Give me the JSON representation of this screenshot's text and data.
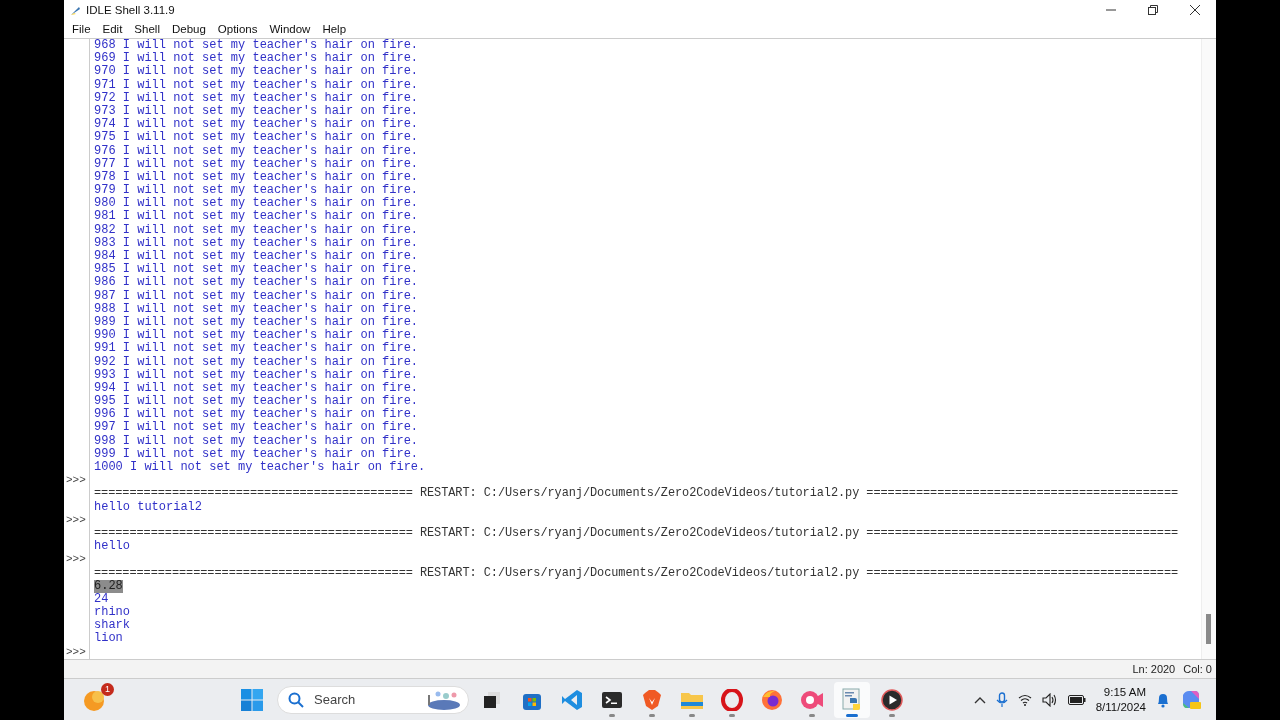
{
  "window": {
    "title": "IDLE Shell 3.11.9"
  },
  "menu": [
    "File",
    "Edit",
    "Shell",
    "Debug",
    "Options",
    "Window",
    "Help"
  ],
  "shell_lines": [
    {
      "kind": "output",
      "text": "968 I will not set my teacher's hair on fire."
    },
    {
      "kind": "output",
      "text": "969 I will not set my teacher's hair on fire."
    },
    {
      "kind": "output",
      "text": "970 I will not set my teacher's hair on fire."
    },
    {
      "kind": "output",
      "text": "971 I will not set my teacher's hair on fire."
    },
    {
      "kind": "output",
      "text": "972 I will not set my teacher's hair on fire."
    },
    {
      "kind": "output",
      "text": "973 I will not set my teacher's hair on fire."
    },
    {
      "kind": "output",
      "text": "974 I will not set my teacher's hair on fire."
    },
    {
      "kind": "output",
      "text": "975 I will not set my teacher's hair on fire."
    },
    {
      "kind": "output",
      "text": "976 I will not set my teacher's hair on fire."
    },
    {
      "kind": "output",
      "text": "977 I will not set my teacher's hair on fire."
    },
    {
      "kind": "output",
      "text": "978 I will not set my teacher's hair on fire."
    },
    {
      "kind": "output",
      "text": "979 I will not set my teacher's hair on fire."
    },
    {
      "kind": "output",
      "text": "980 I will not set my teacher's hair on fire."
    },
    {
      "kind": "output",
      "text": "981 I will not set my teacher's hair on fire."
    },
    {
      "kind": "output",
      "text": "982 I will not set my teacher's hair on fire."
    },
    {
      "kind": "output",
      "text": "983 I will not set my teacher's hair on fire."
    },
    {
      "kind": "output",
      "text": "984 I will not set my teacher's hair on fire."
    },
    {
      "kind": "output",
      "text": "985 I will not set my teacher's hair on fire."
    },
    {
      "kind": "output",
      "text": "986 I will not set my teacher's hair on fire."
    },
    {
      "kind": "output",
      "text": "987 I will not set my teacher's hair on fire."
    },
    {
      "kind": "output",
      "text": "988 I will not set my teacher's hair on fire."
    },
    {
      "kind": "output",
      "text": "989 I will not set my teacher's hair on fire."
    },
    {
      "kind": "output",
      "text": "990 I will not set my teacher's hair on fire."
    },
    {
      "kind": "output",
      "text": "991 I will not set my teacher's hair on fire."
    },
    {
      "kind": "output",
      "text": "992 I will not set my teacher's hair on fire."
    },
    {
      "kind": "output",
      "text": "993 I will not set my teacher's hair on fire."
    },
    {
      "kind": "output",
      "text": "994 I will not set my teacher's hair on fire."
    },
    {
      "kind": "output",
      "text": "995 I will not set my teacher's hair on fire."
    },
    {
      "kind": "output",
      "text": "996 I will not set my teacher's hair on fire."
    },
    {
      "kind": "output",
      "text": "997 I will not set my teacher's hair on fire."
    },
    {
      "kind": "output",
      "text": "998 I will not set my teacher's hair on fire."
    },
    {
      "kind": "output",
      "text": "999 I will not set my teacher's hair on fire."
    },
    {
      "kind": "output",
      "text": "1000 I will not set my teacher's hair on fire."
    },
    {
      "kind": "prompt",
      "prompt": ">>>"
    },
    {
      "kind": "restart",
      "text": "============================================= RESTART: C:/Users/ryanj/Documents/Zero2CodeVideos/tutorial2.py ============================================"
    },
    {
      "kind": "output",
      "text": "hello tutorial2"
    },
    {
      "kind": "prompt",
      "prompt": ">>>"
    },
    {
      "kind": "restart",
      "text": "============================================= RESTART: C:/Users/ryanj/Documents/Zero2CodeVideos/tutorial2.py ============================================"
    },
    {
      "kind": "output",
      "text": "hello"
    },
    {
      "kind": "prompt",
      "prompt": ">>>"
    },
    {
      "kind": "restart",
      "text": "============================================= RESTART: C:/Users/ryanj/Documents/Zero2CodeVideos/tutorial2.py ============================================"
    },
    {
      "kind": "selection",
      "text": "6.28"
    },
    {
      "kind": "output",
      "text": "24"
    },
    {
      "kind": "output",
      "text": "rhino"
    },
    {
      "kind": "output",
      "text": "shark"
    },
    {
      "kind": "output",
      "text": "lion"
    },
    {
      "kind": "prompt",
      "prompt": ">>>"
    }
  ],
  "status_bar": {
    "line": "Ln: 2020",
    "column": "Col: 0"
  },
  "taskbar": {
    "widgets_badge": "1",
    "search": {
      "placeholder": "Search"
    },
    "apps": [
      {
        "kind": "taskview",
        "running": false,
        "selected": false
      },
      {
        "kind": "store",
        "running": false,
        "selected": false
      },
      {
        "kind": "vscode",
        "running": false,
        "selected": false
      },
      {
        "kind": "terminal",
        "running": true,
        "selected": false
      },
      {
        "kind": "brave",
        "running": true,
        "selected": false
      },
      {
        "kind": "folder",
        "running": true,
        "selected": false
      },
      {
        "kind": "opera",
        "running": true,
        "selected": false
      },
      {
        "kind": "firefox",
        "running": false,
        "selected": false
      },
      {
        "kind": "recorder",
        "running": true,
        "selected": false
      },
      {
        "kind": "idle",
        "running": true,
        "selected": true
      },
      {
        "kind": "player",
        "running": true,
        "selected": false
      }
    ],
    "time": "9:15 AM",
    "date": "8/11/2024"
  }
}
